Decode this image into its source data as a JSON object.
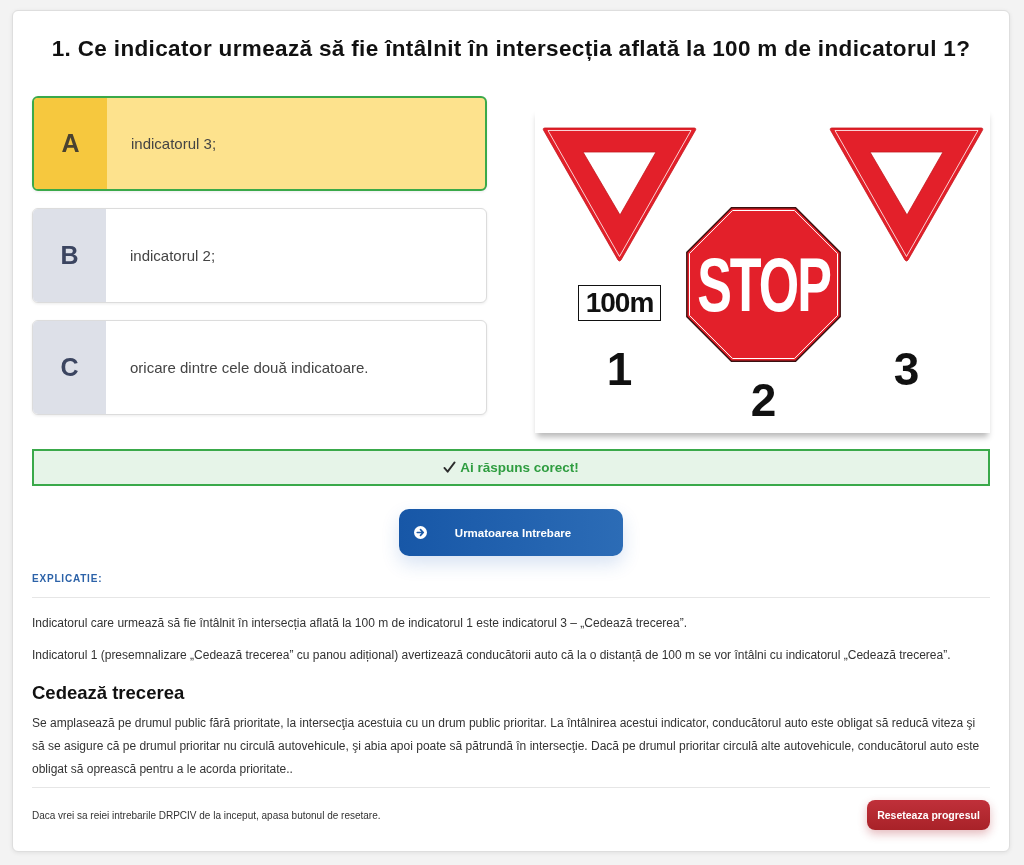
{
  "question": {
    "title": "1. Ce indicator urmează să fie întâlnit în intersecția aflată la 100 m de indicatorul 1?"
  },
  "answers": [
    {
      "letter": "A",
      "text": "indicatorul 3;",
      "selected": true,
      "correct": true
    },
    {
      "letter": "B",
      "text": "indicatorul 2;",
      "selected": false,
      "correct": false
    },
    {
      "letter": "C",
      "text": "oricare dintre cele două indicatoare.",
      "selected": false,
      "correct": false
    }
  ],
  "figure": {
    "signs": [
      {
        "kind": "yield",
        "plate": "100m",
        "number": "1"
      },
      {
        "kind": "stop",
        "text": "STOP",
        "number": "2"
      },
      {
        "kind": "yield",
        "number": "3"
      }
    ]
  },
  "feedback": {
    "kind": "correct",
    "text": "Ai răspuns corect!"
  },
  "next_button": {
    "label": "Urmatoarea Intrebare"
  },
  "explanation": {
    "label": "EXPLICATIE:",
    "paragraphs": [
      "Indicatorul care urmează să fie întâlnit în intersecția aflată la 100 m de indicatorul 1 este indicatorul 3 – „Cedează trecerea”.",
      "Indicatorul 1 (presemnalizare „Cedează trecerea” cu panou adițional) avertizează conducătorii auto că la o distanță de 100 m se vor întâlni cu indicatorul „Cedează trecerea”."
    ],
    "heading": "Cedează trecerea",
    "details": "Se amplasează pe drumul public fără prioritate, la intersecţia acestuia cu un drum public prioritar. La întâlnirea acestui indicator, conducătorul auto este obligat să reducă viteza şi să se asigure că pe drumul prioritar nu circulă autovehicule, şi abia apoi poate să pătrundă în intersecţie. Dacă pe drumul prioritar circulă alte autovehicule, conducătorul auto este obligat să oprească pentru a le acorda prioritate.."
  },
  "footer": {
    "note": "Daca vrei sa reiei intrebarile DRPCIV de la inceput, apasa butonul de resetare.",
    "reset_button": "Reseteaza progresul"
  }
}
